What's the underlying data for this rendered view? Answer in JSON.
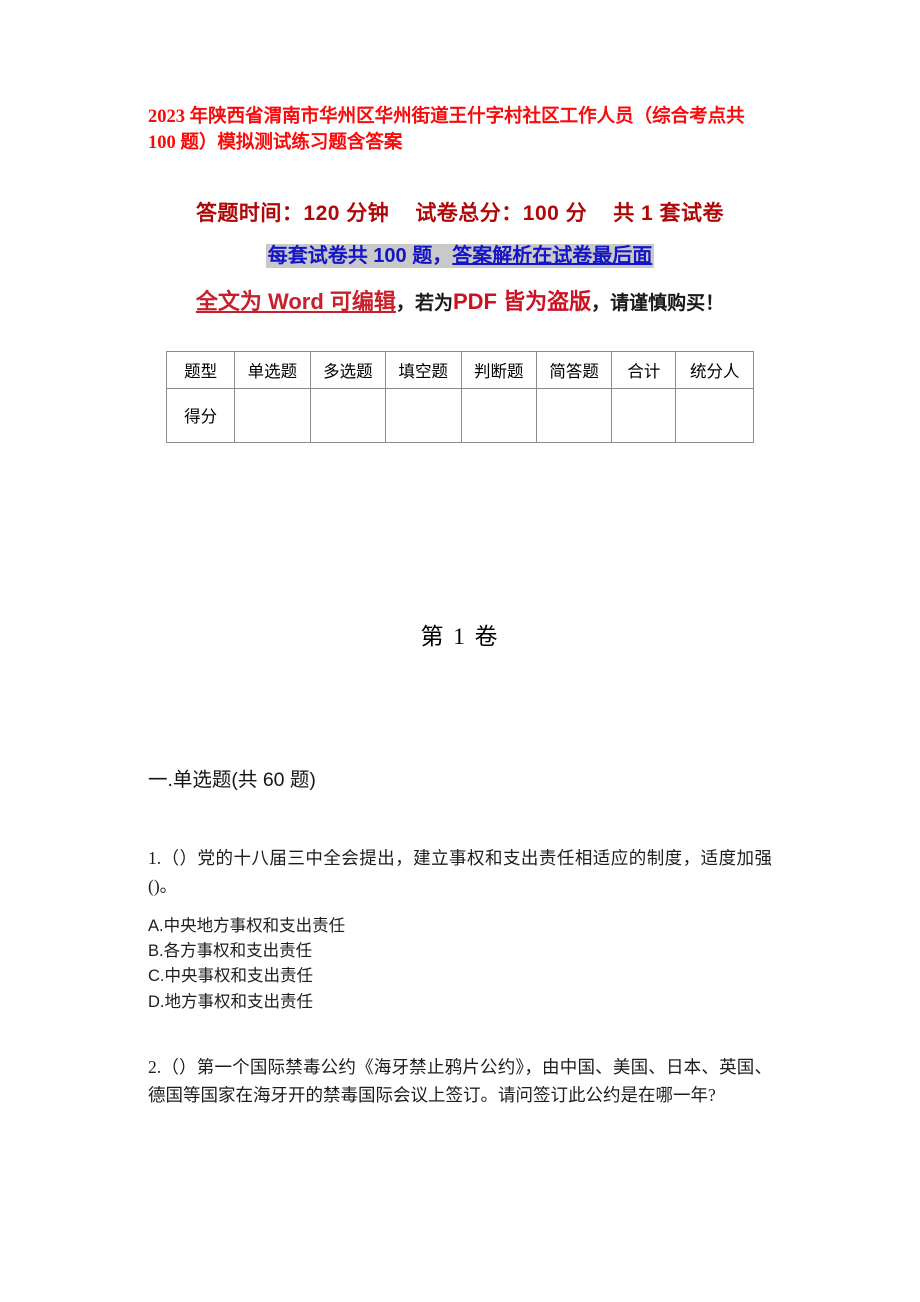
{
  "document": {
    "title": "2023 年陕西省渭南市华州区华州街道王什字村社区工作人员（综合考点共 100 题）模拟测试练习题含答案",
    "colors": {
      "title_red": "#fa0a0a",
      "info_dark_red": "#b00808",
      "highlight_blue": "#1414c8",
      "highlight_bg": "#c9c9c9",
      "crimson": "#cc1122",
      "body_black": "#1d1d1d",
      "table_border": "#8c8c8c"
    }
  },
  "info": {
    "duration_label": "答题时间：120 分钟",
    "total_score_label": "试卷总分：100 分",
    "set_count_label": "共 1 套试卷",
    "per_set_label": "每套试卷共 100 题，",
    "answer_location_label": "答案解析在试卷最后面",
    "notice_word_editable": "全文为 Word 可编辑",
    "notice_comma_1": "，",
    "notice_if": "若为",
    "notice_pdf_pirated": "PDF 皆为盗版",
    "notice_comma_2": "，",
    "notice_caution": "请谨慎购买！"
  },
  "score_table": {
    "headers": [
      "题型",
      "单选题",
      "多选题",
      "填空题",
      "判断题",
      "简答题",
      "合计",
      "统分人"
    ],
    "rows": [
      {
        "label": "得分",
        "cells": [
          "",
          "",
          "",
          "",
          "",
          "",
          ""
        ]
      }
    ]
  },
  "volume": {
    "label": "第 1 卷"
  },
  "section": {
    "heading": "一.单选题(共 60 题)"
  },
  "questions": [
    {
      "number": "1.",
      "text": "1.（）党的十八届三中全会提出，建立事权和支出责任相适应的制度，适度加强()。",
      "options": [
        "A.中央地方事权和支出责任",
        "B.各方事权和支出责任",
        "C.中央事权和支出责任",
        "D.地方事权和支出责任"
      ]
    },
    {
      "number": "2.",
      "text": "2.（）第一个国际禁毒公约《海牙禁止鸦片公约》，由中国、美国、日本、英国、德国等国家在海牙开的禁毒国际会议上签订。请问签订此公约是在哪一年?",
      "options": []
    }
  ]
}
